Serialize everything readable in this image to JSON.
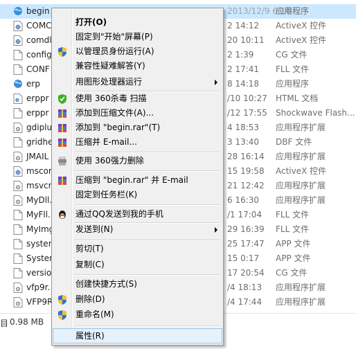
{
  "files": [
    {
      "name": "begin",
      "date": "2013/12/9 6:10",
      "type": "应用程序",
      "icon": "globe-icon",
      "selected": true
    },
    {
      "name": "COMC",
      "date": "2 14:12",
      "type": "ActiveX 控件",
      "icon": "activex-file-icon"
    },
    {
      "name": "comdl",
      "date": "20 10:11",
      "type": "ActiveX 控件",
      "icon": "activex-file-icon"
    },
    {
      "name": "config",
      "date": "2 1:39",
      "type": "CG 文件",
      "icon": "file-icon"
    },
    {
      "name": "CONF",
      "date": "2 17:41",
      "type": "FLL 文件",
      "icon": "file-icon"
    },
    {
      "name": "erp",
      "date": "8 14:18",
      "type": "应用程序",
      "icon": "globe-icon"
    },
    {
      "name": "erppr",
      "date": "/10 10:27",
      "type": "HTML 文档",
      "icon": "ie-html-icon"
    },
    {
      "name": "erppr",
      "date": "/12 17:55",
      "type": "Shockwave Flash...",
      "icon": "file-icon"
    },
    {
      "name": "gdiplu",
      "date": "4 18:53",
      "type": "应用程序扩展",
      "icon": "dll-file-icon"
    },
    {
      "name": "gridhe",
      "date": "3 13:40",
      "type": "DBF 文件",
      "icon": "file-icon"
    },
    {
      "name": "JMAIL",
      "date": "28 16:14",
      "type": "应用程序扩展",
      "icon": "dll-file-icon"
    },
    {
      "name": "mscor",
      "date": "15 19:58",
      "type": "ActiveX 控件",
      "icon": "activex-file-icon"
    },
    {
      "name": "msvcr",
      "date": "21 12:42",
      "type": "应用程序扩展",
      "icon": "dll-file-icon"
    },
    {
      "name": "MyDll.",
      "date": "6 16:30",
      "type": "应用程序扩展",
      "icon": "dll-file-icon"
    },
    {
      "name": "MyFll.",
      "date": "/1 17:04",
      "type": "FLL 文件",
      "icon": "file-icon"
    },
    {
      "name": "MyImg",
      "date": "29 16:39",
      "type": "FLL 文件",
      "icon": "file-icon"
    },
    {
      "name": "systen",
      "date": "25 17:47",
      "type": "APP 文件",
      "icon": "file-icon"
    },
    {
      "name": "System",
      "date": "15 0:17",
      "type": "APP 文件",
      "icon": "file-icon"
    },
    {
      "name": "versio",
      "date": "17 20:54",
      "type": "CG 文件",
      "icon": "file-icon"
    },
    {
      "name": "vfp9r.",
      "date": "/4 18:13",
      "type": "应用程序扩展",
      "icon": "dll-file-icon"
    },
    {
      "name": "VFP9R",
      "date": "/4 17:44",
      "type": "应用程序扩展",
      "icon": "dll-file-icon"
    }
  ],
  "status": {
    "left_char": "目",
    "size": "0.98 MB"
  },
  "menu": {
    "open": "打开(O)",
    "pin_start": "固定到\"开始\"屏幕(P)",
    "run_as_admin": "以管理员身份运行(A)",
    "troubleshoot": "兼容性疑难解答(Y)",
    "run_with_gpu": "用图形处理器运行",
    "scan_360": "使用 360杀毒 扫描",
    "add_archive": "添加到压缩文件(A)...",
    "add_rar": "添加到 \"begin.rar\"(T)",
    "compress_email": "压缩并 E-mail...",
    "force_delete_360": "使用 360强力删除",
    "compress_rar_email": "压缩到 \"begin.rar\" 并 E-mail",
    "pin_taskbar": "固定到任务栏(K)",
    "send_qq": "通过QQ发送到我的手机",
    "send_to": "发送到(N)",
    "cut": "剪切(T)",
    "copy": "复制(C)",
    "create_shortcut": "创建快捷方式(S)",
    "delete": "删除(D)",
    "rename": "重命名(M)",
    "properties": "属性(R)"
  },
  "colors": {
    "selection": "#cce8ff",
    "menu_bg": "#f0f0f0",
    "menu_highlight": "#e5f1fb"
  }
}
